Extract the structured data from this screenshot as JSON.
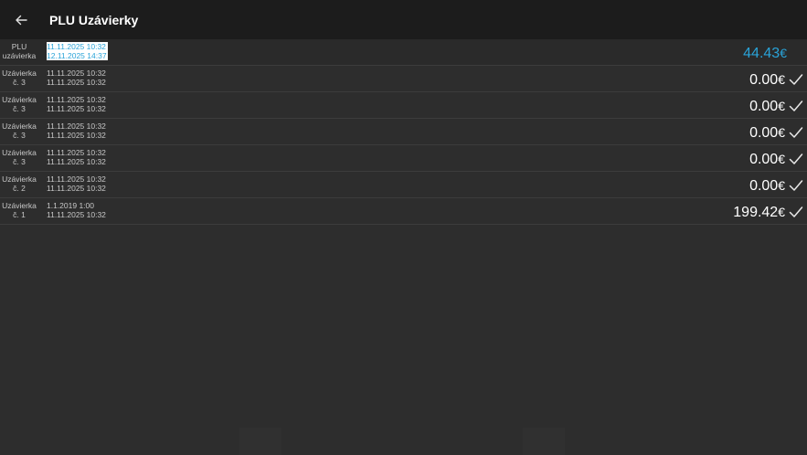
{
  "appbar": {
    "back_icon": "arrow-left-icon",
    "title": "PLU Uzávierky"
  },
  "current": {
    "label_line1": "PLU",
    "label_line2": "uzávierka",
    "date_from": "11.11.2025 10:32",
    "date_to": "12.11.2025 14:37",
    "amount": "44.43",
    "currency": "€",
    "accent_color": "#29a3d8"
  },
  "rows": [
    {
      "label_line1": "Uzávierka",
      "label_line2": "č. 3",
      "date_from": "11.11.2025 10:32",
      "date_to": "11.11.2025 10:32",
      "amount": "0.00",
      "currency": "€",
      "status_icon": "check-icon"
    },
    {
      "label_line1": "Uzávierka",
      "label_line2": "č. 3",
      "date_from": "11.11.2025 10:32",
      "date_to": "11.11.2025 10:32",
      "amount": "0.00",
      "currency": "€",
      "status_icon": "check-icon"
    },
    {
      "label_line1": "Uzávierka",
      "label_line2": "č. 3",
      "date_from": "11.11.2025 10:32",
      "date_to": "11.11.2025 10:32",
      "amount": "0.00",
      "currency": "€",
      "status_icon": "check-icon"
    },
    {
      "label_line1": "Uzávierka",
      "label_line2": "č. 3",
      "date_from": "11.11.2025 10:32",
      "date_to": "11.11.2025 10:32",
      "amount": "0.00",
      "currency": "€",
      "status_icon": "check-icon"
    },
    {
      "label_line1": "Uzávierka",
      "label_line2": "č. 2",
      "date_from": "11.11.2025 10:32",
      "date_to": "11.11.2025 10:32",
      "amount": "0.00",
      "currency": "€",
      "status_icon": "check-icon"
    },
    {
      "label_line1": "Uzávierka",
      "label_line2": "č. 1",
      "date_from": "1.1.2019 1:00",
      "date_to": "11.11.2025 10:32",
      "amount": "199.42",
      "currency": "€",
      "status_icon": "check-icon"
    }
  ]
}
